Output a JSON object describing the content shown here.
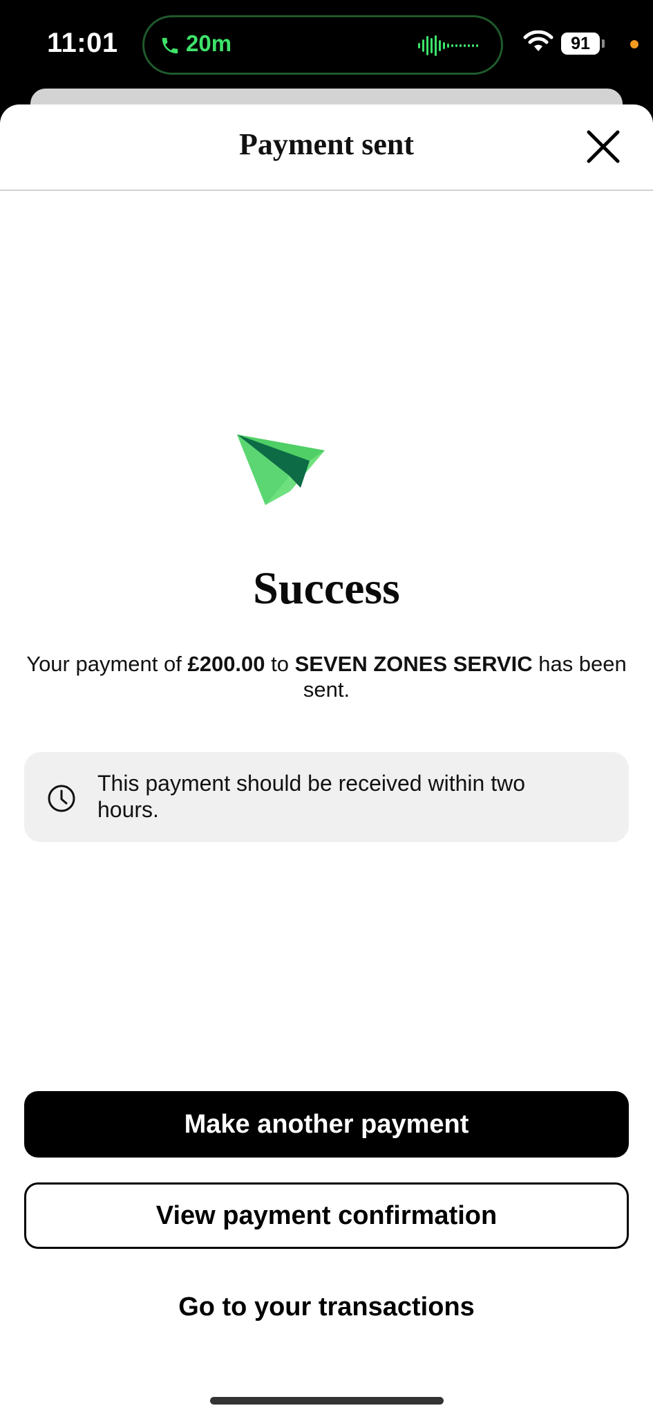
{
  "status_bar": {
    "time": "11:01",
    "call_timer": "20m",
    "battery_level": "91",
    "icons": [
      "phone-icon",
      "waveform-icon",
      "wifi-icon",
      "battery-icon"
    ]
  },
  "header": {
    "title": "Payment sent",
    "close_icon": "close-icon"
  },
  "success": {
    "heading": "Success",
    "message_prefix": "Your payment of ",
    "amount": "£200.00",
    "message_middle": " to ",
    "payee": "SEVEN ZONES SERVIC",
    "message_suffix": " has been sent."
  },
  "info": {
    "icon": "clock-icon",
    "text": "This payment should be received within two hours."
  },
  "actions": {
    "primary_label": "Make another payment",
    "secondary_label": "View payment confirmation",
    "link_label": "Go to your transactions"
  },
  "colors": {
    "accent_green": "#3ee36a",
    "plane_light": "#6ee07e",
    "plane_dark": "#0d6b46",
    "privacy_dot": "#f49a1f"
  }
}
